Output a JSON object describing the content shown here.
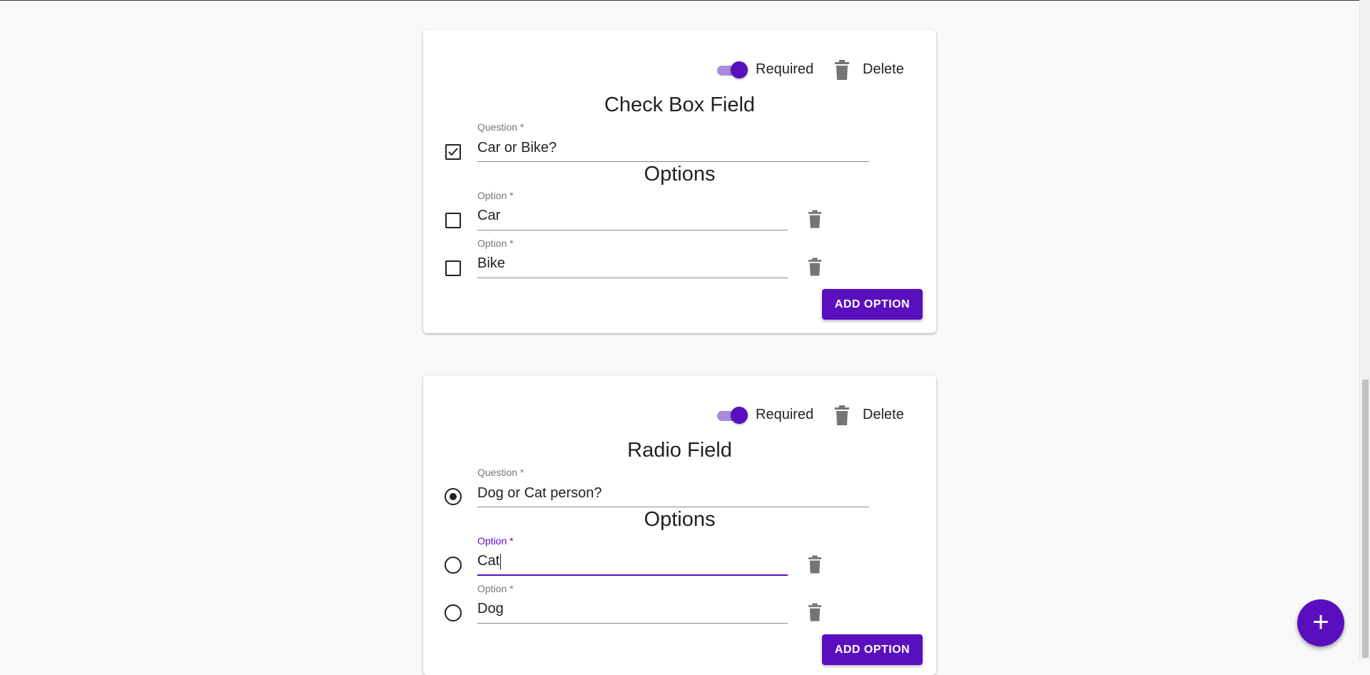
{
  "cards": [
    {
      "required_label": "Required",
      "delete_label": "Delete",
      "field_title": "Check Box Field",
      "question_label": "Question *",
      "question_value": "Car or Bike?",
      "options_title": "Options",
      "option_label": "Option *",
      "options": [
        "Car",
        "Bike"
      ],
      "add_option_label": "ADD OPTION"
    },
    {
      "required_label": "Required",
      "delete_label": "Delete",
      "field_title": "Radio Field",
      "question_label": "Question *",
      "question_value": "Dog or Cat person?",
      "options_title": "Options",
      "option_label": "Option *",
      "options": [
        "Cat",
        "Dog"
      ],
      "add_option_label": "ADD OPTION"
    }
  ],
  "fab": {
    "label": "+",
    "icon": "plus-icon"
  },
  "colors": {
    "accent": "#5a0fbf",
    "accent_light": "#a98bdb"
  }
}
